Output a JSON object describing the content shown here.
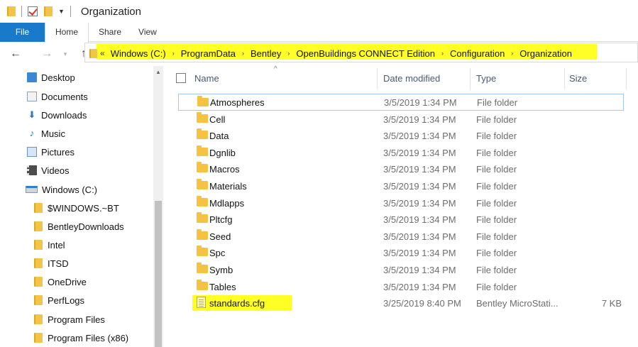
{
  "window": {
    "title": "Organization"
  },
  "ribbon": {
    "tabs": [
      "File",
      "Home",
      "Share",
      "View"
    ]
  },
  "address": {
    "lead": "«",
    "crumbs": [
      "Windows (C:)",
      "ProgramData",
      "Bentley",
      "OpenBuildings CONNECT Edition",
      "Configuration",
      "Organization"
    ],
    "separator": "›"
  },
  "sidebar": {
    "items": [
      {
        "label": "Desktop",
        "icon": "desktop-icon"
      },
      {
        "label": "Documents",
        "icon": "documents-icon"
      },
      {
        "label": "Downloads",
        "icon": "downloads-icon"
      },
      {
        "label": "Music",
        "icon": "music-icon"
      },
      {
        "label": "Pictures",
        "icon": "pictures-icon"
      },
      {
        "label": "Videos",
        "icon": "videos-icon"
      },
      {
        "label": "Windows (C:)",
        "icon": "drive-icon"
      },
      {
        "label": "$WINDOWS.~BT",
        "icon": "folder-icon"
      },
      {
        "label": "BentleyDownloads",
        "icon": "folder-icon"
      },
      {
        "label": "Intel",
        "icon": "folder-icon"
      },
      {
        "label": "ITSD",
        "icon": "folder-icon"
      },
      {
        "label": "OneDrive",
        "icon": "folder-icon"
      },
      {
        "label": "PerfLogs",
        "icon": "folder-icon"
      },
      {
        "label": "Program Files",
        "icon": "folder-icon"
      },
      {
        "label": "Program Files (x86)",
        "icon": "folder-icon"
      }
    ]
  },
  "columns": {
    "name": "Name",
    "date": "Date modified",
    "type": "Type",
    "size": "Size"
  },
  "files": [
    {
      "name": "Atmospheres",
      "date": "3/5/2019 1:34 PM",
      "type": "File folder",
      "size": ""
    },
    {
      "name": "Cell",
      "date": "3/5/2019 1:34 PM",
      "type": "File folder",
      "size": ""
    },
    {
      "name": "Data",
      "date": "3/5/2019 1:34 PM",
      "type": "File folder",
      "size": ""
    },
    {
      "name": "Dgnlib",
      "date": "3/5/2019 1:34 PM",
      "type": "File folder",
      "size": ""
    },
    {
      "name": "Macros",
      "date": "3/5/2019 1:34 PM",
      "type": "File folder",
      "size": ""
    },
    {
      "name": "Materials",
      "date": "3/5/2019 1:34 PM",
      "type": "File folder",
      "size": ""
    },
    {
      "name": "Mdlapps",
      "date": "3/5/2019 1:34 PM",
      "type": "File folder",
      "size": ""
    },
    {
      "name": "Pltcfg",
      "date": "3/5/2019 1:34 PM",
      "type": "File folder",
      "size": ""
    },
    {
      "name": "Seed",
      "date": "3/5/2019 1:34 PM",
      "type": "File folder",
      "size": ""
    },
    {
      "name": "Spc",
      "date": "3/5/2019 1:34 PM",
      "type": "File folder",
      "size": ""
    },
    {
      "name": "Symb",
      "date": "3/5/2019 1:34 PM",
      "type": "File folder",
      "size": ""
    },
    {
      "name": "Tables",
      "date": "3/5/2019 1:34 PM",
      "type": "File folder",
      "size": ""
    },
    {
      "name": "standards.cfg",
      "date": "3/25/2019 8:40 PM",
      "type": "Bentley MicroStati...",
      "size": "7 KB"
    }
  ],
  "colors": {
    "accent": "#1979ca",
    "highlight": "#ffff26",
    "folder": "#f5c242",
    "selection_border": "#9ec8f0"
  }
}
